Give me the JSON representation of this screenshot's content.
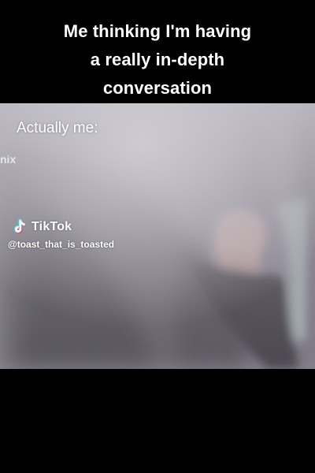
{
  "meme": {
    "caption_lines": [
      "Me thinking I'm having",
      "a really in-depth",
      "conversation"
    ],
    "overlay_text": "Actually me:",
    "edge_text": "nix"
  },
  "watermark": {
    "icon": "tiktok-note-icon",
    "brand": "TikTok",
    "handle": "@toast_that_is_toasted"
  },
  "colors": {
    "background": "#000000",
    "text": "#ffffff",
    "video_tone": "#8d8c94"
  }
}
